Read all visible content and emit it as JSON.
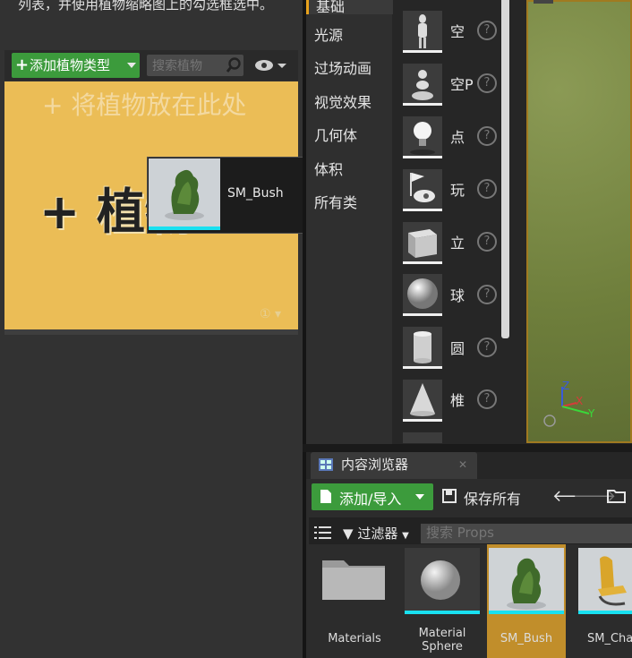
{
  "foliage": {
    "hint": "列表，并使用植物缩略图上的勾选框选中。",
    "add_foliage_type": "添加植物类型",
    "search_placeholder": "搜索植物",
    "drop_hint": "+ 将植物放在此处",
    "drop_big": "+ 植物",
    "drop_icons": "① ▾"
  },
  "drag_tooltip": {
    "label": "SM_Bush"
  },
  "place_mode": {
    "categories": [
      "基础",
      "光源",
      "过场动画",
      "视觉效果",
      "几何体",
      "体积",
      "所有类"
    ],
    "items": [
      {
        "label": "空",
        "icon": "empty-actor-icon"
      },
      {
        "label": "空P",
        "icon": "empty-pawn-icon"
      },
      {
        "label": "点",
        "icon": "point-light-icon"
      },
      {
        "label": "玩",
        "icon": "player-start-icon"
      },
      {
        "label": "立",
        "icon": "cube-icon"
      },
      {
        "label": "球",
        "icon": "sphere-icon"
      },
      {
        "label": "圆",
        "icon": "cylinder-icon"
      },
      {
        "label": "椎",
        "icon": "cone-icon"
      }
    ],
    "help_glyph": "?"
  },
  "viewport": {
    "axis_z": "Z",
    "axis_x": "X",
    "axis_y": "Y"
  },
  "content_browser": {
    "tab_label": "内容浏览器",
    "close_glyph": "✕",
    "add_import": "添加/导入",
    "save_all": "保存所有",
    "back_glyph": "🡐",
    "forward_glyph": "🡒",
    "filters": "过滤器",
    "search_placeholder": "搜索 Props",
    "assets": [
      {
        "name": "Materials",
        "type": "folder"
      },
      {
        "name": "Material\nSphere",
        "type": "material"
      },
      {
        "name": "SM_Bush",
        "type": "mesh",
        "selected": true
      },
      {
        "name": "SM_Chai",
        "type": "mesh"
      }
    ]
  },
  "colors": {
    "accent_green": "#3c9b3c",
    "drop_zone": "#ebbd56",
    "selection": "#c18e2b",
    "asset_bar": "#19e0f0"
  }
}
